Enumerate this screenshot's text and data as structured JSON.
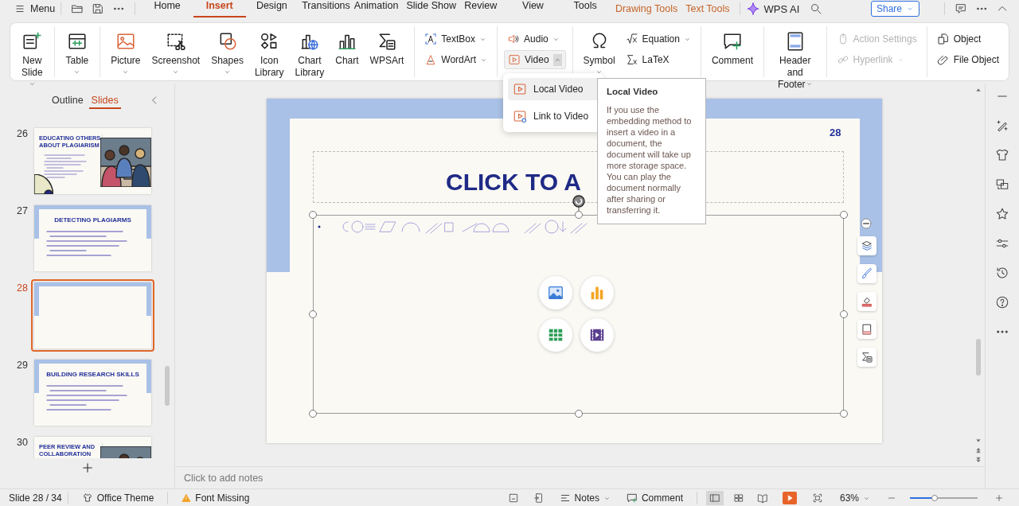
{
  "top_bar": {
    "menu": "Menu",
    "tabs": [
      {
        "label": "Home",
        "selected": false,
        "kind": "main"
      },
      {
        "label": "Insert",
        "selected": true,
        "kind": "main"
      },
      {
        "label": "Design",
        "selected": false,
        "kind": "main"
      },
      {
        "label": "Transitions",
        "selected": false,
        "kind": "main"
      },
      {
        "label": "Animation",
        "selected": false,
        "kind": "main"
      },
      {
        "label": "Slide Show",
        "selected": false,
        "kind": "main"
      },
      {
        "label": "Review",
        "selected": false,
        "kind": "main"
      },
      {
        "label": "View",
        "selected": false,
        "kind": "main"
      },
      {
        "label": "Tools",
        "selected": false,
        "kind": "main"
      },
      {
        "label": "Drawing Tools",
        "selected": false,
        "kind": "context"
      },
      {
        "label": "Text Tools",
        "selected": false,
        "kind": "context"
      }
    ],
    "ai": "WPS AI",
    "share": "Share"
  },
  "ribbon": {
    "groups": [
      {
        "items": [
          {
            "label": "New\nSlide",
            "kind": "large",
            "dropdown": true,
            "disabled": false,
            "expanded": false
          }
        ]
      },
      {
        "items": [
          {
            "label": "Table",
            "kind": "large",
            "dropdown": true,
            "disabled": false,
            "expanded": false
          }
        ]
      },
      {
        "items": [
          {
            "label": "Picture",
            "kind": "large",
            "dropdown": true,
            "disabled": false,
            "expanded": false
          },
          {
            "label": "Screenshot",
            "kind": "large",
            "dropdown": true,
            "disabled": false,
            "expanded": false
          },
          {
            "label": "Shapes",
            "kind": "large",
            "dropdown": true,
            "disabled": false,
            "expanded": false
          },
          {
            "label": "Icon\nLibrary",
            "kind": "large",
            "dropdown": false,
            "disabled": false,
            "expanded": false
          },
          {
            "label": "Chart\nLibrary",
            "kind": "large",
            "dropdown": false,
            "disabled": false,
            "expanded": false
          },
          {
            "label": "Chart",
            "kind": "large",
            "dropdown": false,
            "disabled": false,
            "expanded": false
          },
          {
            "label": "WPSArt",
            "kind": "large",
            "dropdown": false,
            "disabled": false,
            "expanded": false
          }
        ]
      },
      {
        "items": [
          {
            "label": "TextBox",
            "kind": "small",
            "dropdown": true,
            "disabled": false,
            "expanded": false
          },
          {
            "label": "WordArt",
            "kind": "small",
            "dropdown": true,
            "disabled": false,
            "expanded": false
          }
        ]
      },
      {
        "items": [
          {
            "label": "Audio",
            "kind": "small",
            "dropdown": true,
            "disabled": false,
            "expanded": false
          },
          {
            "label": "Video",
            "kind": "small",
            "dropdown": true,
            "disabled": false,
            "expanded": true
          }
        ]
      },
      {
        "items": [
          {
            "label": "Symbol",
            "kind": "large",
            "dropdown": true,
            "disabled": false,
            "expanded": false
          },
          {
            "label": "Equation",
            "kind": "small",
            "dropdown": true,
            "disabled": false,
            "expanded": false
          },
          {
            "label": "LaTeX",
            "kind": "small",
            "dropdown": false,
            "disabled": false,
            "expanded": false
          }
        ]
      },
      {
        "items": [
          {
            "label": "Comment",
            "kind": "large",
            "dropdown": false,
            "disabled": false,
            "expanded": false
          }
        ]
      },
      {
        "items": [
          {
            "label": "Header and\nFooter",
            "kind": "large",
            "dropdown": true,
            "disabled": false,
            "expanded": false
          }
        ]
      },
      {
        "items": [
          {
            "label": "Action Settings",
            "kind": "small",
            "dropdown": false,
            "disabled": true,
            "expanded": false
          },
          {
            "label": "Hyperlink",
            "kind": "small",
            "dropdown": true,
            "disabled": true,
            "expanded": false
          }
        ]
      },
      {
        "items": [
          {
            "label": "Object",
            "kind": "small",
            "dropdown": false,
            "disabled": false,
            "expanded": false
          },
          {
            "label": "File Object",
            "kind": "small",
            "dropdown": false,
            "disabled": false,
            "expanded": false
          }
        ]
      }
    ]
  },
  "video_menu": {
    "items": [
      {
        "label": "Local Video",
        "selected": true
      },
      {
        "label": "Link to Video",
        "selected": false
      }
    ]
  },
  "tooltip": {
    "title": "Local Video",
    "text": "If you use the embedding method to insert a video in a document, the document will take up more storage space. You can play the document normally after sharing or transferring it."
  },
  "slides_panel": {
    "tabs": [
      {
        "label": "Outline",
        "selected": false
      },
      {
        "label": "Slides",
        "selected": true
      }
    ],
    "thumbnails": [
      {
        "number": "26",
        "selected": false,
        "title": "EDUCATING OTHERS ABOUT PLAGIARISM"
      },
      {
        "number": "27",
        "selected": false,
        "kind": "bullets",
        "title": "DETECTING PLAGIARMS"
      },
      {
        "number": "28",
        "selected": true,
        "kind": "blank"
      },
      {
        "number": "29",
        "selected": false,
        "kind": "bullets",
        "title": "BUILDING RESEARCH SKILLS"
      },
      {
        "number": "30",
        "selected": false,
        "kind": "title_photo",
        "title": "PEER REVIEW AND COLLABORATION"
      }
    ]
  },
  "slide": {
    "number": "28",
    "title_start": "CLICK TO A"
  },
  "notes": {
    "placeholder": "Click to add notes"
  },
  "status_bar": {
    "slide": "Slide 28 / 34",
    "theme": "Office Theme",
    "font": "Font Missing",
    "notes": "Notes",
    "comment": "Comment",
    "views": [
      {
        "selected": true
      },
      {
        "selected": false
      },
      {
        "selected": false
      }
    ],
    "zoom": "63%",
    "zoom_slider": {
      "level": 0.37
    }
  }
}
